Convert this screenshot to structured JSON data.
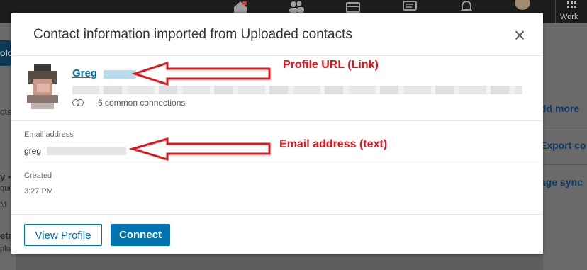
{
  "background": {
    "left_fragments": [
      "oloa",
      "cts",
      "y •",
      "quid",
      "M",
      "etric",
      "plac"
    ],
    "right_items": [
      "dd more",
      "Export co",
      "age sync"
    ],
    "nav_work_label": "Work"
  },
  "modal": {
    "title": "Contact information imported from Uploaded contacts",
    "profile_name": "Greg",
    "connections": "6 common connections",
    "email_label": "Email address",
    "email_value": "greg",
    "created_label": "Created",
    "created_value": "3:27 PM",
    "view_profile_label": "View Profile",
    "connect_label": "Connect"
  },
  "annotations": {
    "profile_url": "Profile URL (Link)",
    "email": "Email address (text)"
  },
  "colors": {
    "accent": "#0073b1",
    "annotation": "#e4141b"
  }
}
